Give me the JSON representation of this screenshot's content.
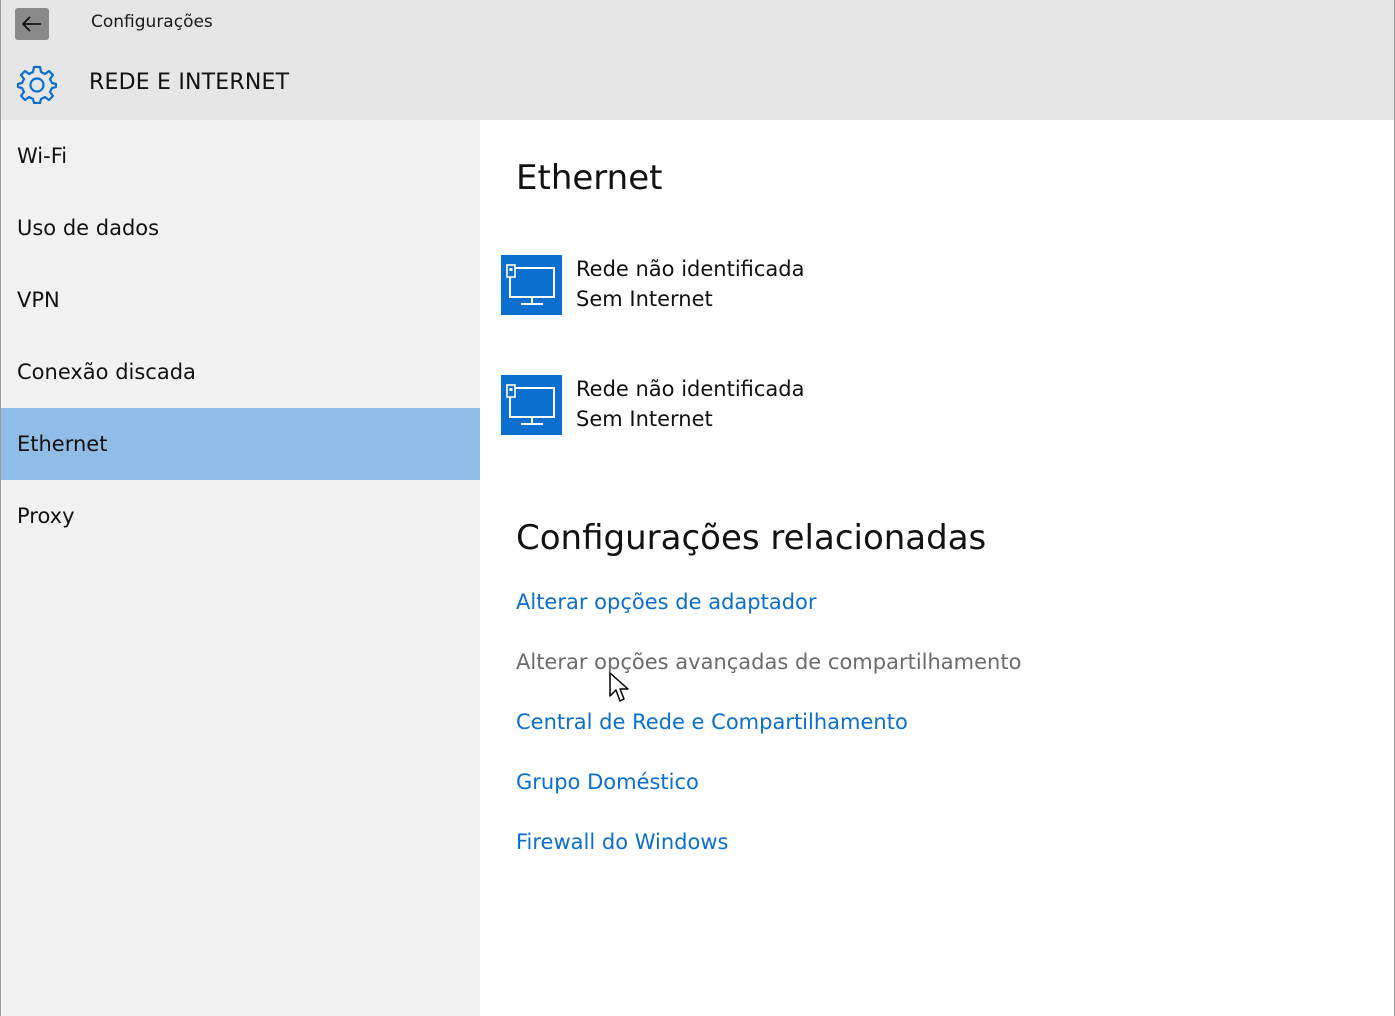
{
  "window": {
    "title": "Configurações",
    "back_icon": "arrow-left-icon"
  },
  "header": {
    "icon": "gear-icon",
    "title": "REDE E INTERNET",
    "accent_color": "#0a6fcf"
  },
  "sidebar": {
    "items": [
      {
        "label": "Wi-Fi",
        "selected": false
      },
      {
        "label": "Uso de dados",
        "selected": false
      },
      {
        "label": "VPN",
        "selected": false
      },
      {
        "label": "Conexão discada",
        "selected": false
      },
      {
        "label": "Ethernet",
        "selected": true
      },
      {
        "label": "Proxy",
        "selected": false
      }
    ],
    "selected_color": "#90bde8"
  },
  "main": {
    "title": "Ethernet",
    "networks": [
      {
        "name": "Rede não identificada",
        "status": "Sem Internet",
        "icon": "monitor-network-icon"
      },
      {
        "name": "Rede não identificada",
        "status": "Sem Internet",
        "icon": "monitor-network-icon"
      }
    ],
    "related": {
      "title": "Configurações relacionadas",
      "links": [
        {
          "label": "Alterar opções de adaptador",
          "hovered": false
        },
        {
          "label": "Alterar opções avançadas de compartilhamento",
          "hovered": true
        },
        {
          "label": "Central de Rede e Compartilhamento",
          "hovered": false
        },
        {
          "label": "Grupo Doméstico",
          "hovered": false
        },
        {
          "label": "Firewall do Windows",
          "hovered": false
        }
      ]
    }
  }
}
